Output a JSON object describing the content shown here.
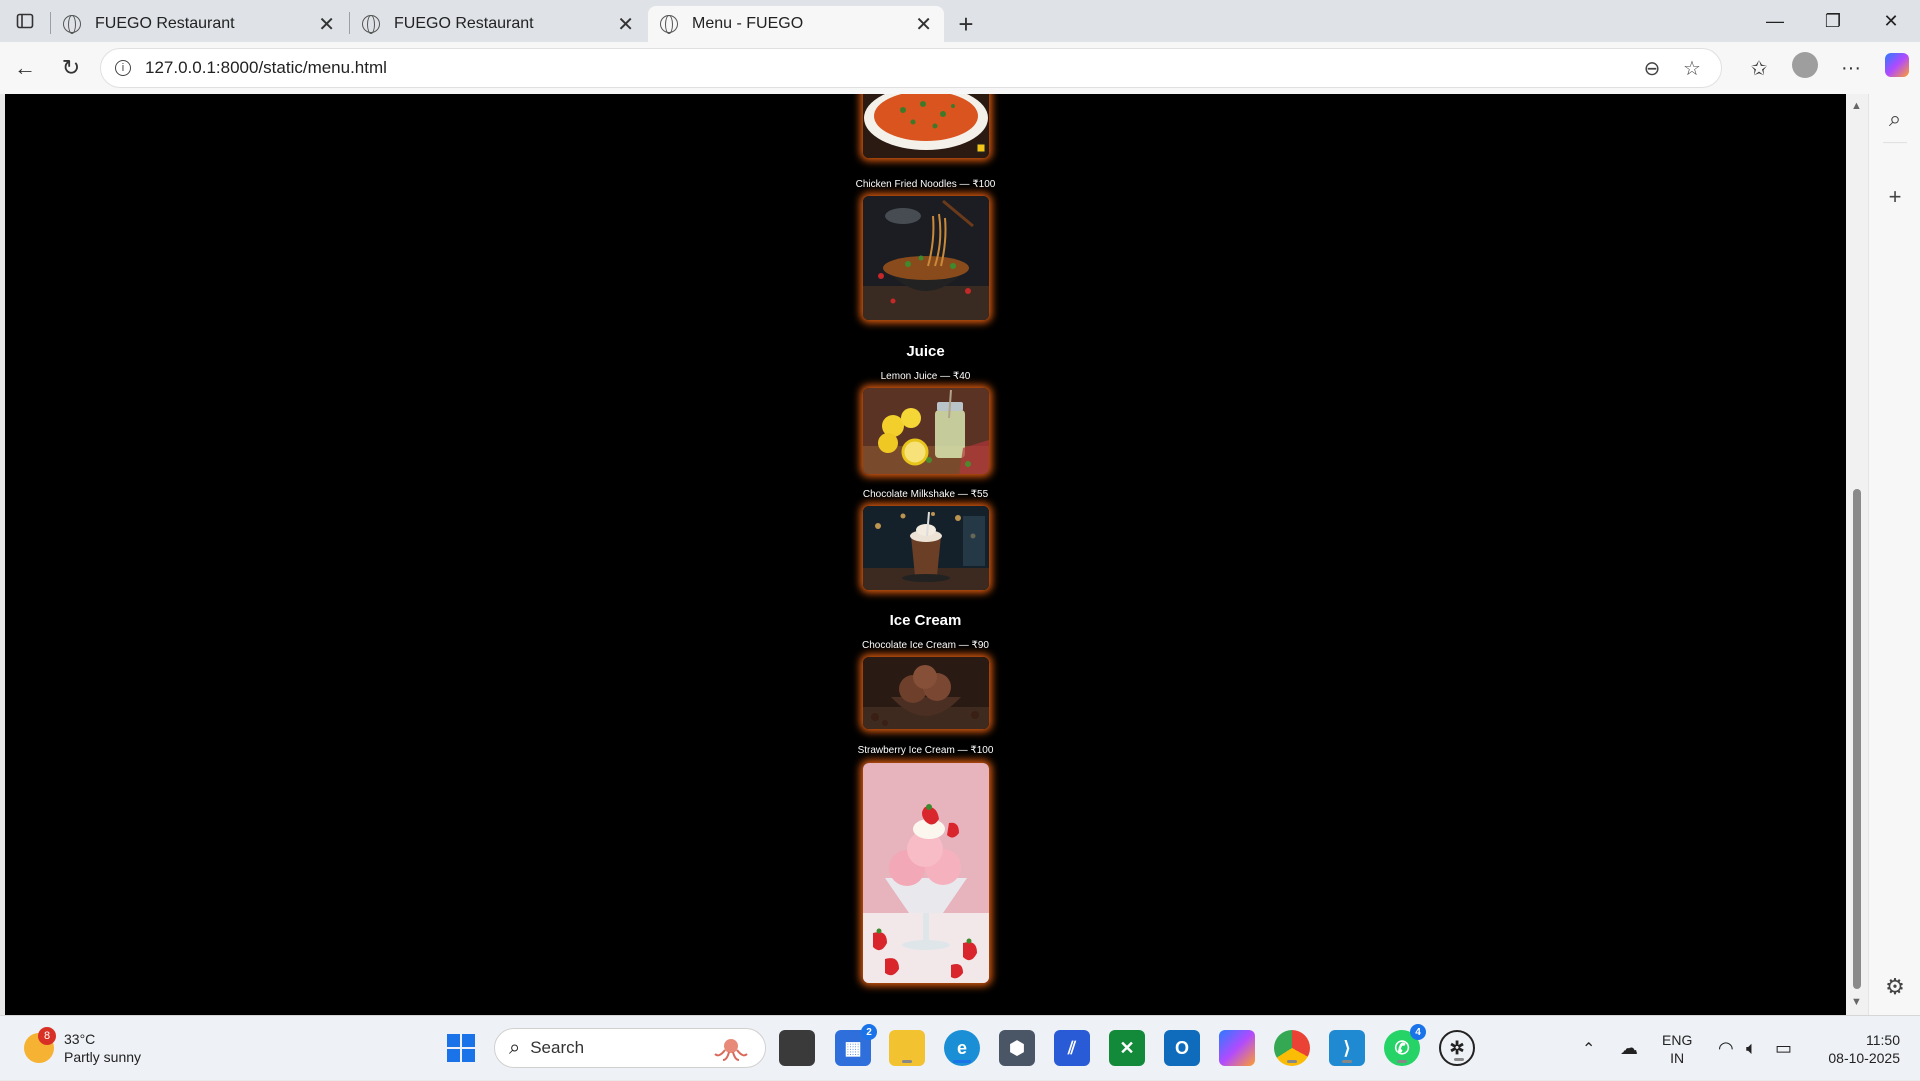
{
  "browser": {
    "tabs": [
      {
        "title": "FUEGO Restaurant",
        "active": false
      },
      {
        "title": "FUEGO Restaurant",
        "active": false
      },
      {
        "title": "Menu - FUEGO",
        "active": true
      }
    ],
    "url": "127.0.0.1:8000/static/menu.html"
  },
  "menu": {
    "categories": [
      {
        "name": "Juice"
      },
      {
        "name": "Ice Cream"
      }
    ],
    "items": [
      {
        "label": "Chicken Fried Noodles — ₹100"
      },
      {
        "label": "Lemon Juice — ₹40"
      },
      {
        "label": "Chocolate Milkshake — ₹55"
      },
      {
        "label": "Chocolate Ice Cream — ₹90"
      },
      {
        "label": "Strawberry Ice Cream — ₹100"
      }
    ]
  },
  "taskbar": {
    "weather_badge": "8",
    "temperature": "33°C",
    "condition": "Partly sunny",
    "search_placeholder": "Search",
    "store_badge": "2",
    "whatsapp_badge": "4",
    "language": "ENG",
    "region": "IN",
    "time": "11:50",
    "date": "08-10-2025"
  },
  "colors": {
    "page_background": "#000000",
    "image_glow": "#d95a10",
    "accent": "#1a73e8"
  }
}
